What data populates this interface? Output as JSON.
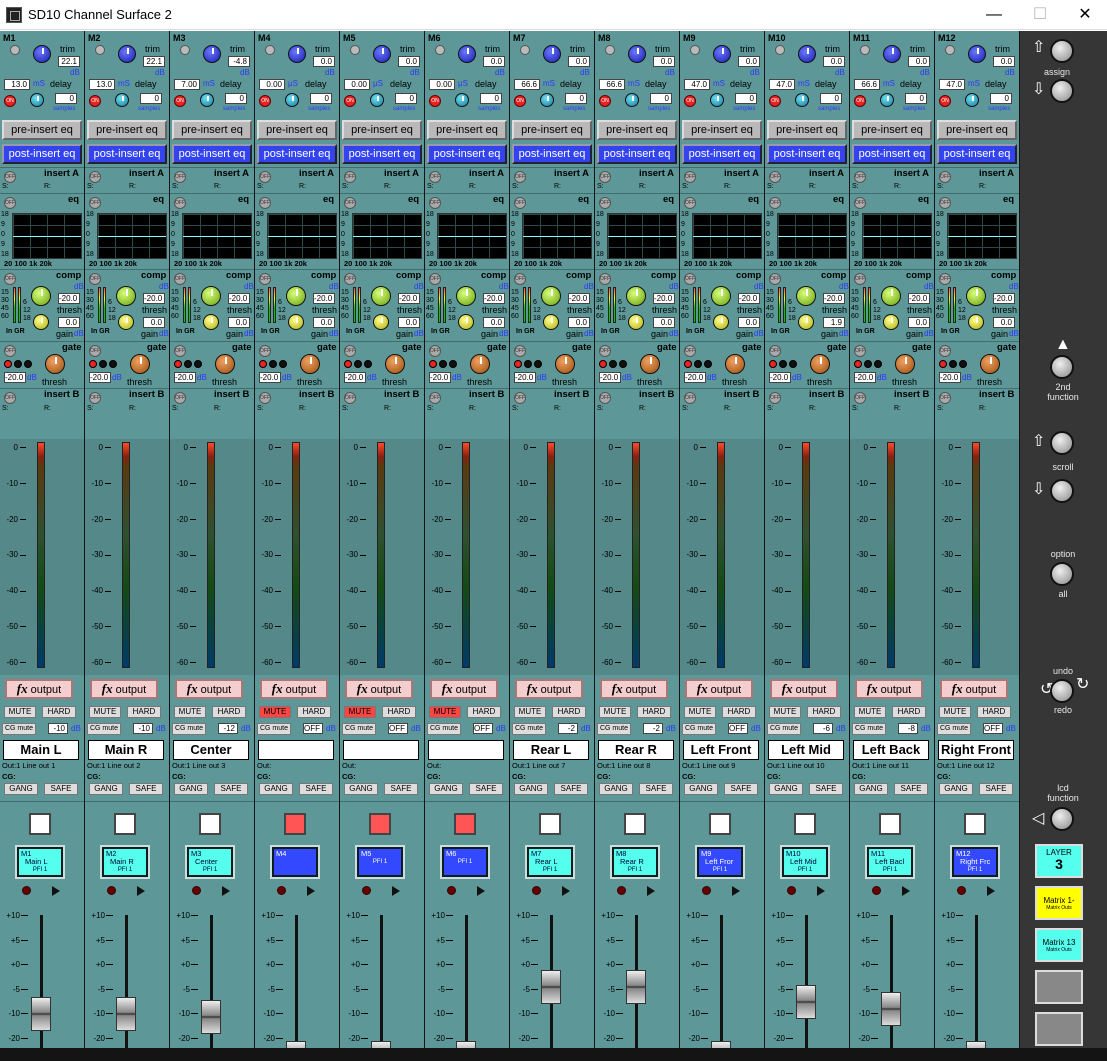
{
  "window": {
    "title": "SD10 Channel Surface 2",
    "min": "—",
    "max": "☐",
    "close": "✕"
  },
  "labels": {
    "trim": "trim",
    "db": "dB",
    "ms": "mS",
    "us": "µS",
    "delay": "delay",
    "samples": "samples",
    "on": "ON",
    "off": "OFF",
    "pre": "pre-insert eq",
    "post": "post-insert eq",
    "insA": "insert A",
    "insB": "insert B",
    "s": "S:",
    "r": "R:",
    "eq": "eq",
    "comp": "comp",
    "thresh": "thresh",
    "gain": "gain",
    "ingr": "In GR",
    "gate": "gate",
    "fx": "fx",
    "output": "output",
    "mute": "MUTE",
    "hard": "HARD",
    "cgmute": "CG mute",
    "gang": "GANG",
    "safe": "SAFE",
    "cg": "CG:",
    "eq_scale": [
      "18",
      "9",
      "0",
      "9",
      "18"
    ],
    "eq_freq": "20 100   1k   20k",
    "comp_scale": [
      "15",
      "30",
      "45",
      "60"
    ],
    "comp_scale2": [
      "6",
      "12",
      "18"
    ],
    "meter_scale": [
      "0",
      "-10",
      "-20",
      "-30",
      "-40",
      "-50",
      "-60"
    ],
    "fader_scale": [
      "+10",
      "+5",
      "+0",
      "-5",
      "-10",
      "-20"
    ]
  },
  "channels": [
    {
      "id": "M1",
      "trim": "22.1",
      "delay": "13.0",
      "dunit": "mS",
      "samples": "0",
      "thresh": "-20.0",
      "gain": "0.0",
      "gate": "-20.0",
      "mute": false,
      "cg": "-10",
      "name": "Main L",
      "out": "Out:1 Line out 1",
      "sel_red": false,
      "lcd": [
        "M1",
        "Main L",
        "PFI 1"
      ],
      "lcd_blue": false,
      "fader": 0.68
    },
    {
      "id": "M2",
      "trim": "22.1",
      "delay": "13.0",
      "dunit": "mS",
      "samples": "0",
      "thresh": "-20.0",
      "gain": "0.0",
      "gate": "-20.0",
      "mute": false,
      "cg": "-10",
      "name": "Main R",
      "out": "Out:1 Line out 2",
      "sel_red": false,
      "lcd": [
        "M2",
        "Main R",
        "PFI 1"
      ],
      "lcd_blue": false,
      "fader": 0.68
    },
    {
      "id": "M3",
      "trim": "-4.8",
      "delay": "7.00",
      "dunit": "mS",
      "samples": "0",
      "thresh": "-20.0",
      "gain": "0.0",
      "gate": "-20.0",
      "mute": false,
      "cg": "-12",
      "name": "Center",
      "out": "Out:1 Line out 3",
      "sel_red": false,
      "lcd": [
        "M3",
        "Center",
        "PFI 1"
      ],
      "lcd_blue": false,
      "fader": 0.71
    },
    {
      "id": "M4",
      "trim": "0.0",
      "delay": "0.00",
      "dunit": "µS",
      "samples": "0",
      "thresh": "-20.0",
      "gain": "0.0",
      "gate": "-20.0",
      "mute": true,
      "cg": "OFF",
      "name": "",
      "out": "Out:",
      "sel_red": true,
      "lcd": [
        "M4",
        "",
        ""
      ],
      "lcd_blue": true,
      "fader": null
    },
    {
      "id": "M5",
      "trim": "0.0",
      "delay": "0.00",
      "dunit": "µS",
      "samples": "0",
      "thresh": "-20.0",
      "gain": "0.0",
      "gate": "-20.0",
      "mute": true,
      "cg": "OFF",
      "name": "",
      "out": "Out:",
      "sel_red": true,
      "lcd": [
        "M5",
        "",
        "PFI 1"
      ],
      "lcd_blue": true,
      "fader": null
    },
    {
      "id": "M6",
      "trim": "0.0",
      "delay": "0.00",
      "dunit": "µS",
      "samples": "0",
      "thresh": "-20.0",
      "gain": "0.0",
      "gate": "-20.0",
      "mute": true,
      "cg": "OFF",
      "name": "",
      "out": "Out:",
      "sel_red": true,
      "lcd": [
        "M6",
        "",
        "PFI 1"
      ],
      "lcd_blue": true,
      "fader": null
    },
    {
      "id": "M7",
      "trim": "0.0",
      "delay": "66.6",
      "dunit": "mS",
      "samples": "0",
      "thresh": "-20.0",
      "gain": "0.0",
      "gate": "-20.0",
      "mute": false,
      "cg": "-2",
      "name": "Rear L",
      "out": "Out:1 Line out 7",
      "sel_red": false,
      "lcd": [
        "M7",
        "Rear L",
        "PFI 1"
      ],
      "lcd_blue": false,
      "fader": 0.46
    },
    {
      "id": "M8",
      "trim": "0.0",
      "delay": "66.6",
      "dunit": "mS",
      "samples": "0",
      "thresh": "-20.0",
      "gain": "0.0",
      "gate": "-20.0",
      "mute": false,
      "cg": "-2",
      "name": "Rear R",
      "out": "Out:1 Line out 8",
      "sel_red": false,
      "lcd": [
        "M8",
        "Rear R",
        "PFI 1"
      ],
      "lcd_blue": false,
      "fader": 0.46
    },
    {
      "id": "M9",
      "trim": "0.0",
      "delay": "47.0",
      "dunit": "mS",
      "samples": "0",
      "thresh": "-20.0",
      "gain": "0.0",
      "gate": "-20.0",
      "mute": false,
      "cg": "OFF",
      "name": "Left Front",
      "out": "Out:1 Line out 9",
      "sel_red": false,
      "lcd": [
        "M9",
        "Left Fror",
        "PFI 1"
      ],
      "lcd_blue": true,
      "fader": null
    },
    {
      "id": "M10",
      "trim": "0.0",
      "delay": "47.0",
      "dunit": "mS",
      "samples": "0",
      "thresh": "-20.0",
      "gain": "1.9",
      "gate": "-20.0",
      "mute": false,
      "cg": "-6",
      "name": "Left Mid",
      "out": "Out:1 Line out 10",
      "sel_red": false,
      "lcd": [
        "M10",
        "Left Mid",
        "PFI 1"
      ],
      "lcd_blue": false,
      "fader": 0.58
    },
    {
      "id": "M11",
      "trim": "0.0",
      "delay": "66.6",
      "dunit": "mS",
      "samples": "0",
      "thresh": "-20.0",
      "gain": "0.0",
      "gate": "-20.0",
      "mute": false,
      "cg": "-8",
      "name": "Left Back",
      "out": "Out:1 Line out 11",
      "sel_red": false,
      "lcd": [
        "M11",
        "Left Bacl",
        "PFI 1"
      ],
      "lcd_blue": false,
      "fader": 0.64
    },
    {
      "id": "M12",
      "trim": "0.0",
      "delay": "47.0",
      "dunit": "mS",
      "samples": "0",
      "thresh": "-20.0",
      "gain": "0.0",
      "gate": "-20.0",
      "mute": false,
      "cg": "OFF",
      "name": "Right Front",
      "out": "Out:1 Line out 12",
      "sel_red": false,
      "lcd": [
        "M12",
        "Right Frc",
        "PFI 1"
      ],
      "lcd_blue": true,
      "fader": null
    }
  ],
  "side": {
    "assign": "assign",
    "second": "2nd",
    "function": "function",
    "scroll": "scroll",
    "option": "option",
    "all": "all",
    "undo": "undo",
    "redo": "redo",
    "lcd": "lcd",
    "lcd_function": "function",
    "layer": "LAYER",
    "layer_num": "3",
    "matrix1": "Matrix 1-",
    "matrix1_sub": "Matrix Outs",
    "matrix13": "Matrix 13",
    "matrix13_sub": "Matrix Outs"
  },
  "colors": {
    "strip": "#5d9797",
    "mute_on": "#ff4444",
    "post_eq": "#3344ee"
  }
}
